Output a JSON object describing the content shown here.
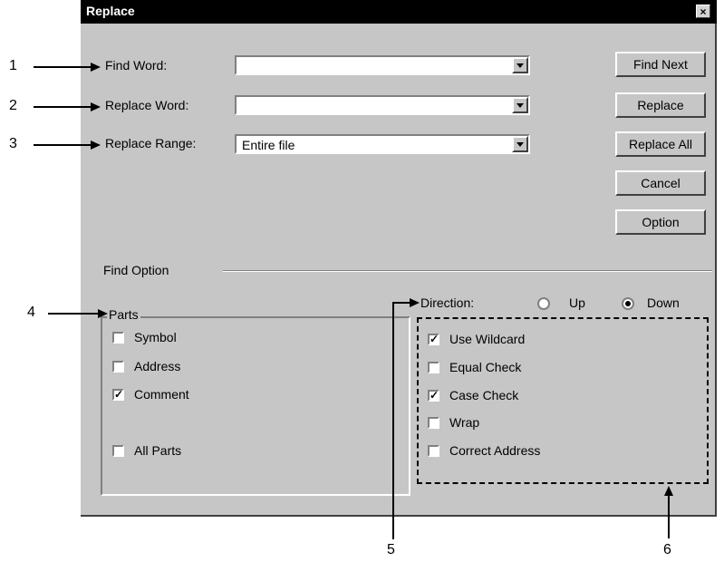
{
  "dialog": {
    "title": "Replace",
    "close_glyph": "×"
  },
  "fields": {
    "find_word": {
      "label": "Find Word:",
      "value": ""
    },
    "replace_word": {
      "label": "Replace Word:",
      "value": ""
    },
    "replace_range": {
      "label": "Replace Range:",
      "value": "Entire file"
    }
  },
  "buttons": {
    "find_next": "Find Next",
    "replace": "Replace",
    "replace_all": "Replace All",
    "cancel": "Cancel",
    "option": "Option"
  },
  "find_option": {
    "label": "Find Option",
    "parts": {
      "label": "Parts",
      "items": [
        {
          "label": "Symbol",
          "checked": false
        },
        {
          "label": "Address",
          "checked": false
        },
        {
          "label": "Comment",
          "checked": true
        },
        {
          "label": "All Parts",
          "checked": false
        }
      ]
    },
    "direction": {
      "label": "Direction:",
      "up": "Up",
      "down": "Down",
      "selected": "Down"
    },
    "options": [
      {
        "label": "Use Wildcard",
        "checked": true
      },
      {
        "label": "Equal Check",
        "checked": false
      },
      {
        "label": "Case Check",
        "checked": true
      },
      {
        "label": "Wrap",
        "checked": false
      },
      {
        "label": "Correct Address",
        "checked": false
      }
    ]
  },
  "callouts": {
    "c1": "1",
    "c2": "2",
    "c3": "3",
    "c4": "4",
    "c5": "5",
    "c6": "6"
  },
  "check_glyph": "✓"
}
